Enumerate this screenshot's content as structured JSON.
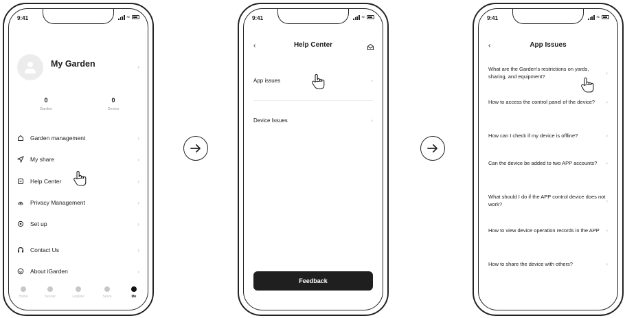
{
  "status_bar": {
    "time": "9:41"
  },
  "screen1": {
    "profile": {
      "name": "My Garden"
    },
    "stats": [
      {
        "value": "0",
        "label": "Garden"
      },
      {
        "value": "0",
        "label": "Device"
      }
    ],
    "menu": [
      {
        "label": "Garden management",
        "icon": "home-icon"
      },
      {
        "label": "My share",
        "icon": "send-icon"
      },
      {
        "label": "Help Center",
        "icon": "help-icon"
      },
      {
        "label": "Privacy Management",
        "icon": "fingerprint-icon"
      },
      {
        "label": "Set up",
        "icon": "settings-icon"
      },
      {
        "label": "Contact Us",
        "icon": "headset-icon"
      },
      {
        "label": "About iGarden",
        "icon": "info-icon"
      }
    ],
    "tabs": [
      {
        "label": "Home",
        "active": false
      },
      {
        "label": "Scenel",
        "active": false
      },
      {
        "label": "Explore",
        "active": false
      },
      {
        "label": "Serve",
        "active": false
      },
      {
        "label": "Me",
        "active": true
      }
    ]
  },
  "screen2": {
    "title": "Help Center",
    "rows": [
      {
        "label": "App issues"
      },
      {
        "label": "Device Issues"
      }
    ],
    "feedback_label": "Feedback"
  },
  "screen3": {
    "title": "App Issues",
    "questions": [
      "What are the Garden's restrictions on yards, sharing, and equipment?",
      "How to access the control panel of the device?",
      "How can I check if my device is offline?",
      "Can the device be added to two APP accounts?",
      "What should I do if the APP control device does not work?",
      "How to view device operation records in the APP",
      "How to share the device with others?"
    ]
  },
  "colors": {
    "accent": "#1f1f1f",
    "muted": "#9a9a9a"
  }
}
